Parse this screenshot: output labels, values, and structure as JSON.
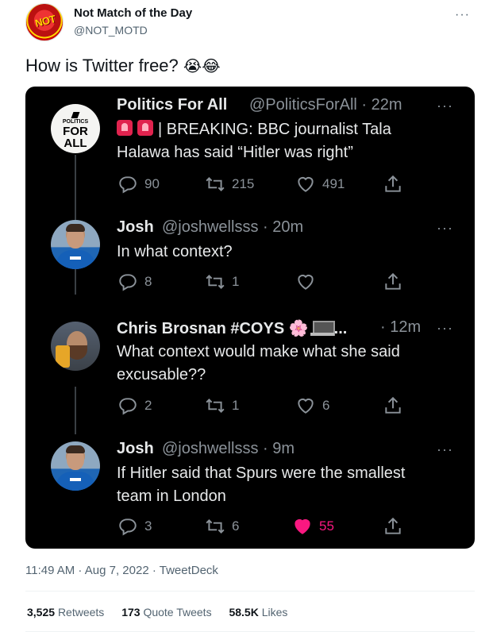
{
  "author": {
    "avatar_text": "NOT",
    "display_name": "Not Match of the Day",
    "handle": "@NOT_MOTD",
    "more_icon": "more-horizontal-icon"
  },
  "tweet": {
    "text": "How is Twitter free?",
    "emojis": "😭😂"
  },
  "embedded": {
    "posts": [
      {
        "avatar_lines": [
          "POLITICS",
          "FOR",
          "ALL"
        ],
        "name": "Politics For All",
        "meta": "@PoliticsForAll · 22m",
        "line1": "| BREAKING: BBC journalist Tala",
        "line2": "Halawa has said “Hitler was right”",
        "replies": "90",
        "retweets": "215",
        "likes": "491"
      },
      {
        "name": "Josh",
        "meta": "@joshwellsss · 20m",
        "line1": "In what context?",
        "replies": "8",
        "retweets": "1",
        "likes": ""
      },
      {
        "name": "Chris Brosnan #COYS",
        "name_emoji": "🌸",
        "name_ellipsis": "...",
        "meta": "· 12m",
        "line1": "What context would make what she said",
        "line2": "excusable??",
        "replies": "2",
        "retweets": "1",
        "likes": "6"
      },
      {
        "name": "Josh",
        "meta": "@joshwellsss · 9m",
        "line1": "If Hitler said that Spurs were the smallest",
        "line2": "team in London",
        "replies": "3",
        "retweets": "6",
        "likes": "55"
      }
    ],
    "like_active_color": "#f91880"
  },
  "footer": {
    "timestamp": "11:49 AM · Aug 7, 2022 · TweetDeck",
    "retweets_count": "3,525",
    "retweets_label": "Retweets",
    "quotes_count": "173",
    "quotes_label": "Quote Tweets",
    "likes_count": "58.5K",
    "likes_label": "Likes"
  }
}
